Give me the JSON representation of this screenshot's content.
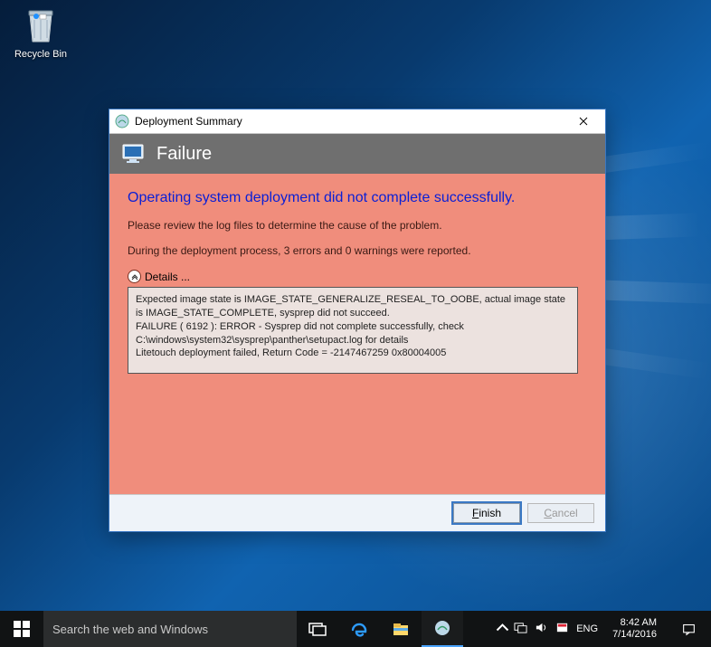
{
  "desktop": {
    "recycle_bin_label": "Recycle Bin"
  },
  "dialog": {
    "title": "Deployment Summary",
    "banner_heading": "Failure",
    "headline": "Operating system deployment did not complete successfully.",
    "instruction": "Please review the log files to determine the cause of the problem.",
    "summary_line": "During the deployment process, 3 errors and 0 warnings were reported.",
    "details_label": "Details ...",
    "details_lines": [
      "Expected image state is IMAGE_STATE_GENERALIZE_RESEAL_TO_OOBE, actual image state is IMAGE_STATE_COMPLETE, sysprep did not succeed.",
      "FAILURE ( 6192 ): ERROR - Sysprep did not complete successfully, check C:\\windows\\system32\\sysprep\\panther\\setupact.log for details",
      "Litetouch deployment failed, Return Code = -2147467259  0x80004005"
    ],
    "buttons": {
      "finish": "Finish",
      "cancel": "Cancel"
    }
  },
  "taskbar": {
    "search_placeholder": "Search the web and Windows",
    "language": "ENG",
    "time": "8:42 AM",
    "date": "7/14/2016"
  }
}
